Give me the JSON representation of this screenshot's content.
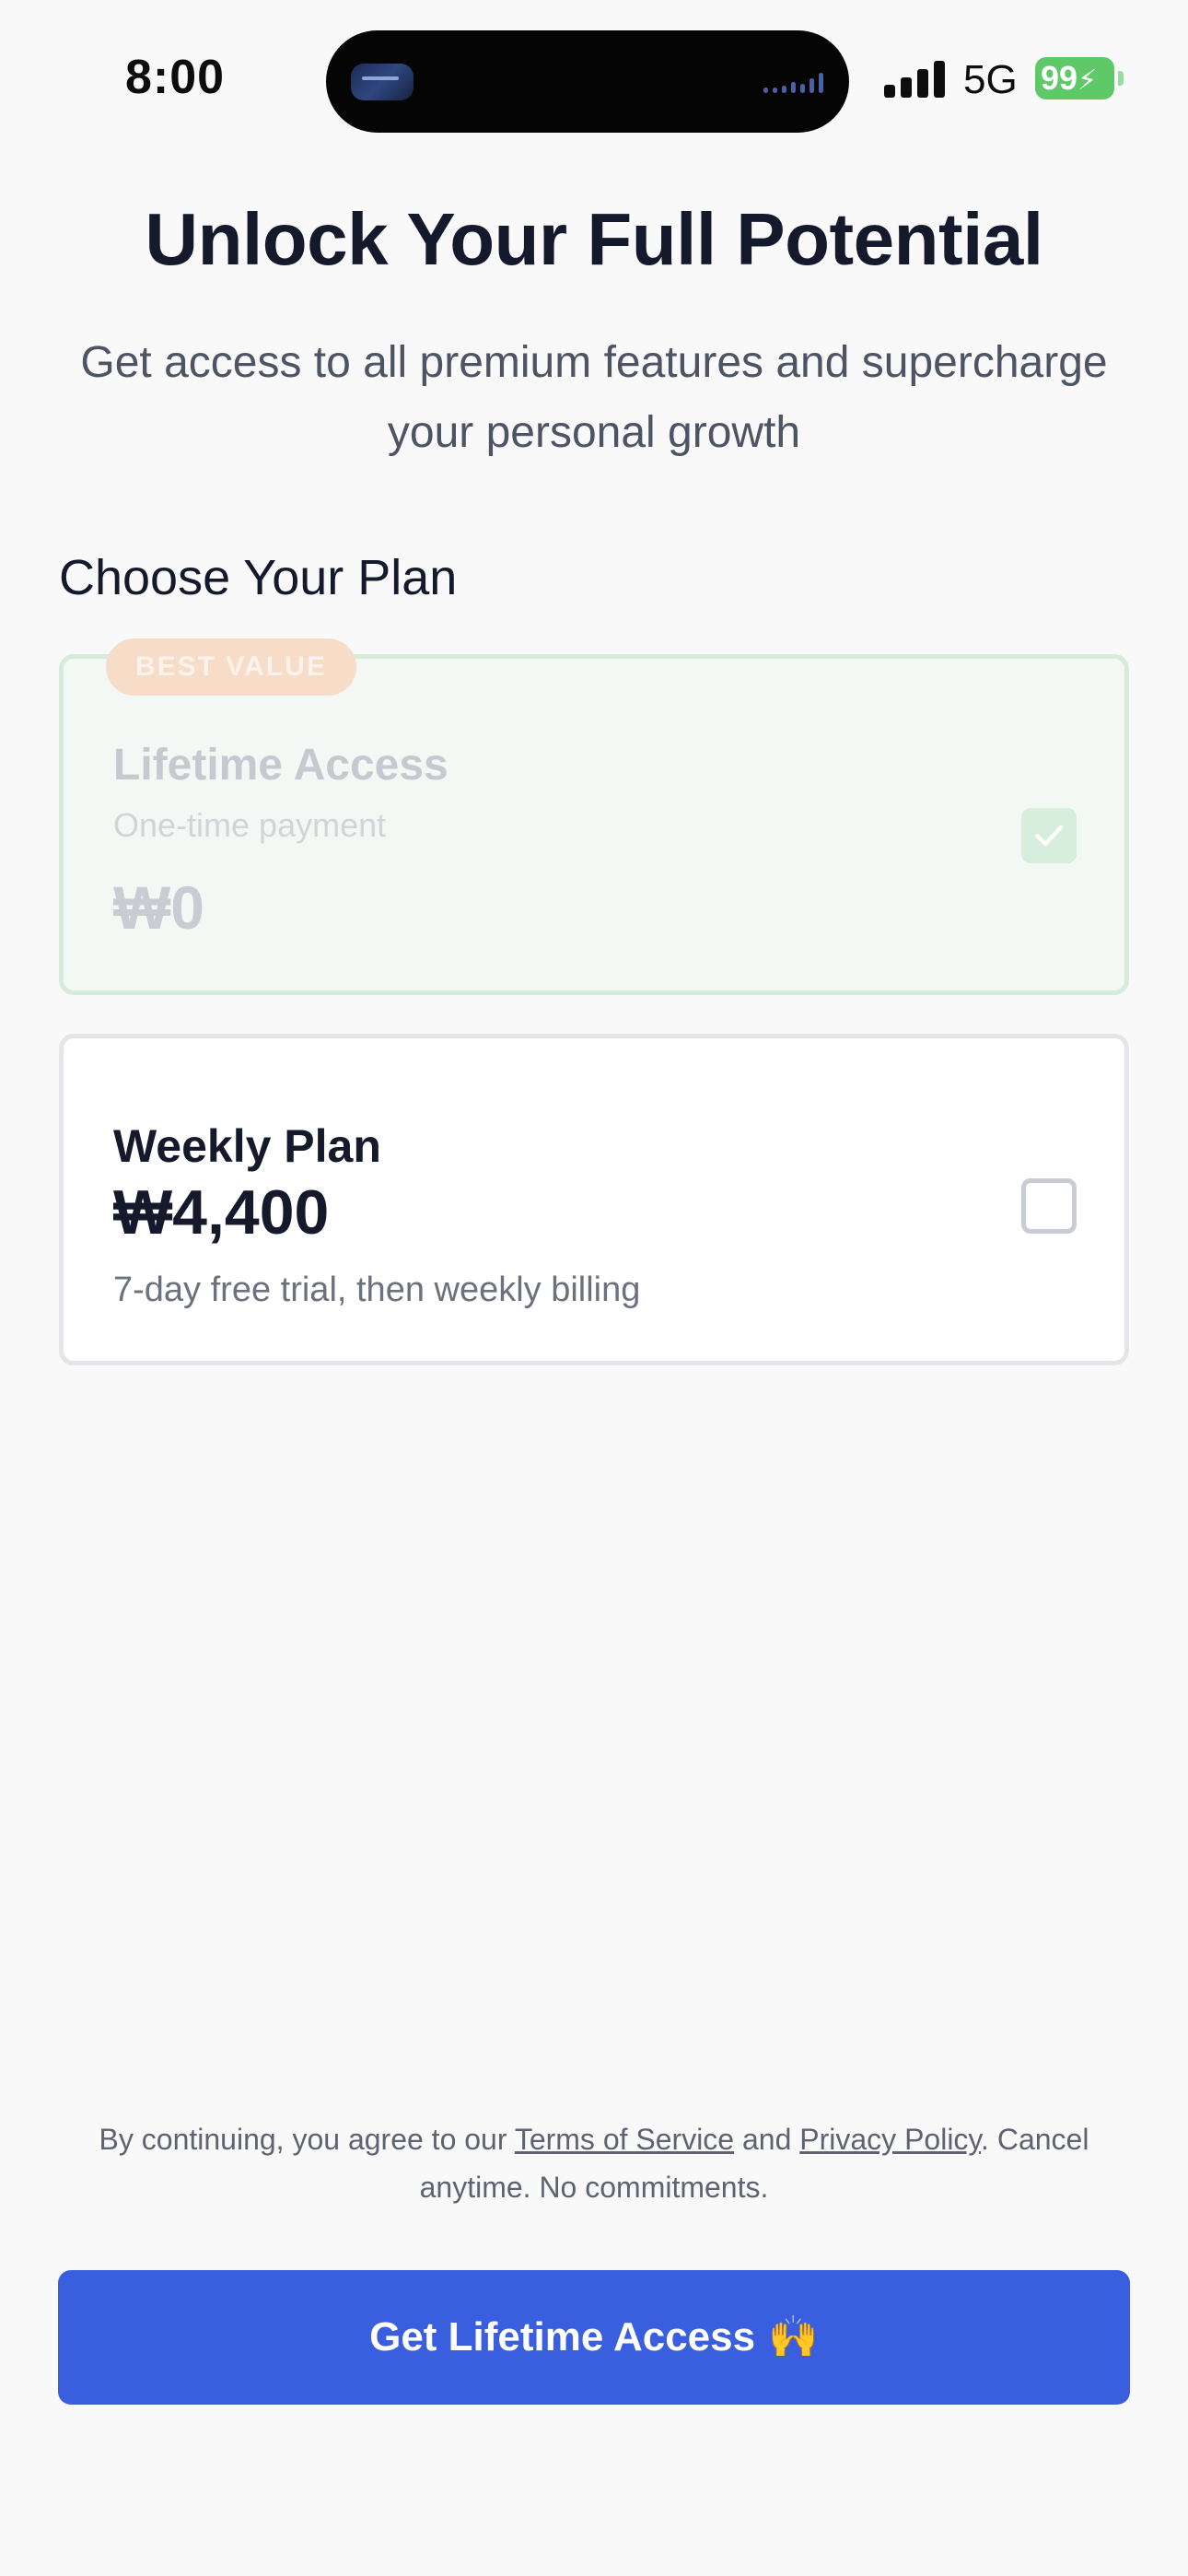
{
  "status_bar": {
    "time": "8:00",
    "network": "5G",
    "battery": "99"
  },
  "header": {
    "title": "Unlock Your Full Potential",
    "subtitle": "Get access to all premium features and supercharge your personal growth"
  },
  "plans": {
    "section_title": "Choose Your Plan",
    "lifetime": {
      "badge": "BEST VALUE",
      "name": "Lifetime Access",
      "description": "One-time payment",
      "price": "₩0",
      "selected": true
    },
    "weekly": {
      "name": "Weekly Plan",
      "price": "₩4,400",
      "description": "7-day free trial, then weekly billing",
      "selected": false
    }
  },
  "footer": {
    "legal_prefix": "By continuing, you agree to our ",
    "terms_link": "Terms of Service",
    "legal_and": " and ",
    "privacy_link": "Privacy Policy",
    "legal_suffix": ". Cancel anytime. No commitments.",
    "cta_label": "Get Lifetime Access",
    "cta_emoji": "🙌"
  },
  "colors": {
    "accent": "#3a5fde",
    "selected_border": "#d4ecd9",
    "badge": "#f7dcc8",
    "battery": "#5fc96a"
  }
}
